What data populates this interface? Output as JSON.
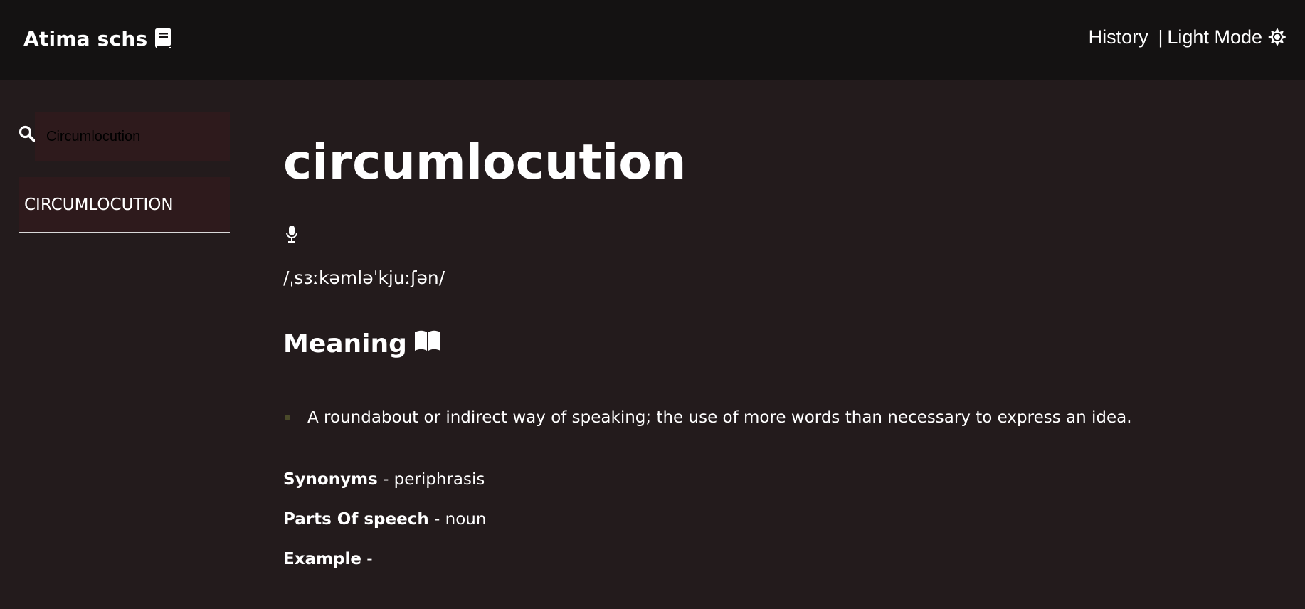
{
  "header": {
    "brand": "Atima schs",
    "brand_icon": "book-icon",
    "nav_history": "History",
    "nav_separator": "|",
    "nav_theme": "Light Mode",
    "theme_icon": "sun-icon"
  },
  "sidebar": {
    "search_value": "Circumlocution",
    "search_icon": "search-icon",
    "results": [
      "CIRCUMLOCUTION"
    ]
  },
  "entry": {
    "word": "circumlocution",
    "audio_icon": "microphone-icon",
    "phonetic": "/ˌsɜːkəmləˈkjuːʃən/",
    "meaning_heading": "Meaning",
    "meaning_icon": "book-open-icon",
    "definitions": [
      "A roundabout or indirect way of speaking; the use of more words than necessary to express an idea."
    ],
    "synonyms_label": "Synonyms",
    "synonyms_value": " - periphrasis",
    "pos_label": "Parts Of speech",
    "pos_value": " - noun",
    "example_label": "Example",
    "example_value": " -"
  },
  "colors": {
    "header_bg": "#141212",
    "page_bg": "#231b1c",
    "input_bg": "#2e1a1c",
    "text": "#ffffff"
  }
}
